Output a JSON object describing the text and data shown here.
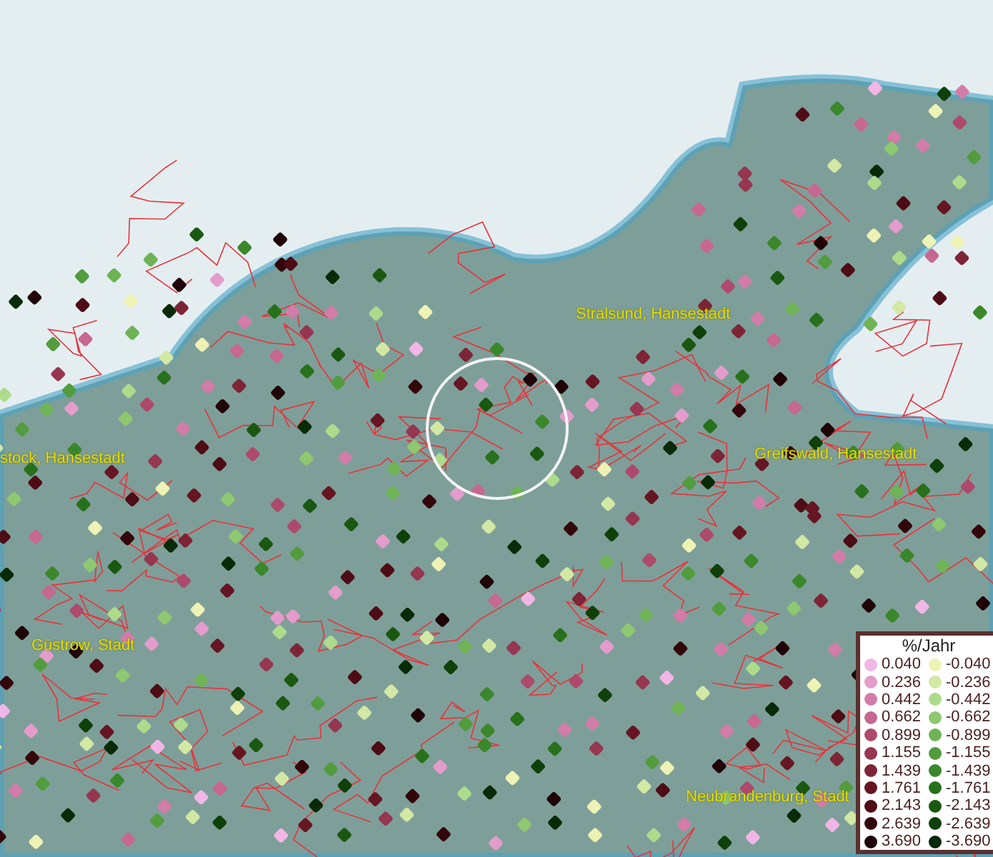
{
  "map": {
    "places": [
      {
        "label": "Stralsund, Hansestadt"
      },
      {
        "label": "stock, Hansestadt"
      },
      {
        "label": "Greifswald, Hansestadt"
      },
      {
        "label": "Güstrow, Stadt"
      },
      {
        "label": "Neubrandenburg, Stadt"
      }
    ]
  },
  "legend": {
    "title": "%/Jahr",
    "rows": [
      {
        "positive": {
          "value": "0.040",
          "color": "#f2b6e6"
        },
        "negative": {
          "value": "-0.040",
          "color": "#eef2b4"
        }
      },
      {
        "positive": {
          "value": "0.236",
          "color": "#e39ccb"
        },
        "negative": {
          "value": "-0.236",
          "color": "#d2e8a4"
        }
      },
      {
        "positive": {
          "value": "0.442",
          "color": "#d27ca8"
        },
        "negative": {
          "value": "-0.442",
          "color": "#addb8c"
        }
      },
      {
        "positive": {
          "value": "0.662",
          "color": "#c66890"
        },
        "negative": {
          "value": "-0.662",
          "color": "#8ec870"
        }
      },
      {
        "positive": {
          "value": "0.899",
          "color": "#ad4a6c"
        },
        "negative": {
          "value": "-0.899",
          "color": "#6fb356"
        }
      },
      {
        "positive": {
          "value": "1.155",
          "color": "#963650"
        },
        "negative": {
          "value": "-1.155",
          "color": "#529c3e"
        }
      },
      {
        "positive": {
          "value": "1.439",
          "color": "#7d2536"
        },
        "negative": {
          "value": "-1.439",
          "color": "#3b872c"
        }
      },
      {
        "positive": {
          "value": "1.761",
          "color": "#661622"
        },
        "negative": {
          "value": "-1.761",
          "color": "#28711c"
        }
      },
      {
        "positive": {
          "value": "2.143",
          "color": "#4e0c14"
        },
        "negative": {
          "value": "-2.143",
          "color": "#1a5812"
        }
      },
      {
        "positive": {
          "value": "2.639",
          "color": "#33060a"
        },
        "negative": {
          "value": "-2.639",
          "color": "#0f400a"
        }
      },
      {
        "positive": {
          "value": "3.690",
          "color": "#1f0306"
        },
        "negative": {
          "value": "-3.690",
          "color": "#082a06"
        }
      }
    ]
  }
}
